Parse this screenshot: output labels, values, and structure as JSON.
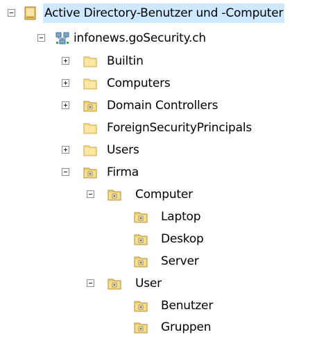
{
  "tree": {
    "root": {
      "label": "Active Directory-Benutzer und -Computer",
      "expanded": true,
      "icon": "ad-console-icon"
    },
    "domain": {
      "label": "infonews.goSecurity.ch",
      "expanded": true,
      "icon": "domain-icon"
    },
    "items": [
      {
        "label": "Builtin",
        "expander": "plus",
        "icon": "folder-icon"
      },
      {
        "label": "Computers",
        "expander": "plus",
        "icon": "folder-icon"
      },
      {
        "label": "Domain Controllers",
        "expander": "plus",
        "icon": "ou-icon"
      },
      {
        "label": "ForeignSecurityPrincipals",
        "expander": "none",
        "icon": "folder-icon"
      },
      {
        "label": "Users",
        "expander": "plus",
        "icon": "folder-icon"
      },
      {
        "label": "Firma",
        "expander": "minus",
        "icon": "ou-icon"
      },
      {
        "label": "Computer",
        "expander": "minus",
        "icon": "ou-icon"
      },
      {
        "label": "Laptop",
        "expander": "none",
        "icon": "ou-icon"
      },
      {
        "label": "Deskop",
        "expander": "none",
        "icon": "ou-icon"
      },
      {
        "label": "Server",
        "expander": "none",
        "icon": "ou-icon"
      },
      {
        "label": "User",
        "expander": "minus",
        "icon": "ou-icon"
      },
      {
        "label": "Benutzer",
        "expander": "none",
        "icon": "ou-icon"
      },
      {
        "label": "Gruppen",
        "expander": "none",
        "icon": "ou-icon"
      }
    ]
  }
}
